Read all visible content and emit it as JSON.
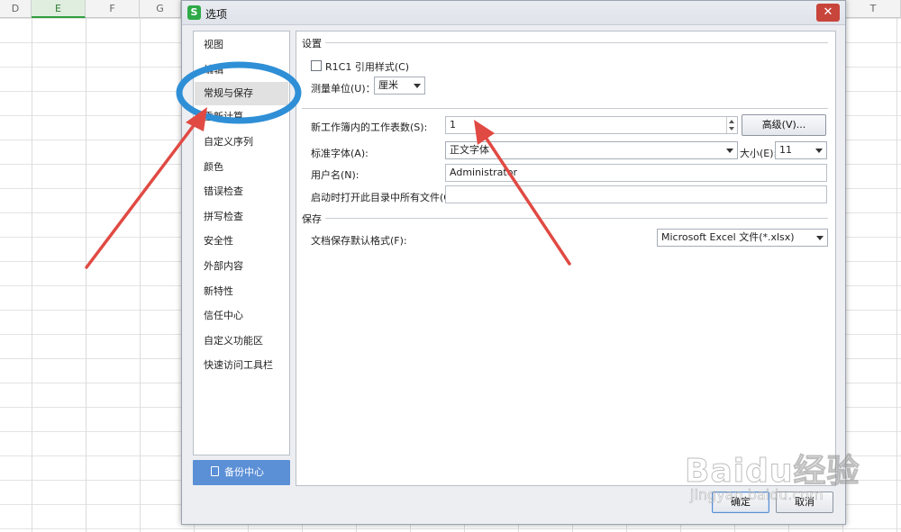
{
  "spreadsheet": {
    "columns": [
      "D",
      "E",
      "F",
      "G",
      "T"
    ],
    "selected_column": "E"
  },
  "dialog": {
    "title": "选项",
    "app_icon": "S",
    "close_label": "✕"
  },
  "nav": {
    "items": [
      {
        "label": "视图"
      },
      {
        "label": "编辑"
      },
      {
        "label": "常规与保存"
      },
      {
        "label": "重新计算"
      },
      {
        "label": "自定义序列"
      },
      {
        "label": "颜色"
      },
      {
        "label": "错误检查"
      },
      {
        "label": "拼写检查"
      },
      {
        "label": "安全性"
      },
      {
        "label": "外部内容"
      },
      {
        "label": "新特性"
      },
      {
        "label": "信任中心"
      },
      {
        "label": "自定义功能区"
      },
      {
        "label": "快速访问工具栏"
      }
    ],
    "active_index": 2,
    "backup_label": "备份中心"
  },
  "settings": {
    "group_title": "设置",
    "r1c1_label": "R1C1 引用样式(C)",
    "r1c1_checked": false,
    "unit_label": "测量单位(U)：",
    "unit_value": "厘米",
    "sheets_label": "新工作簿内的工作表数(S):",
    "sheets_value": "1",
    "advanced_label": "高级(V)...",
    "font_label": "标准字体(A):",
    "font_value": "正文字体",
    "size_label": "大小(E):",
    "size_value": "11",
    "username_label": "用户名(N):",
    "username_value": "Administrator",
    "startup_label": "启动时打开此目录中所有文件(O):",
    "startup_value": ""
  },
  "save": {
    "group_title": "保存",
    "format_label": "文档保存默认格式(F):",
    "format_value": "Microsoft Excel 文件(*.xlsx)"
  },
  "footer": {
    "ok_label": "确定",
    "cancel_label": "取消"
  },
  "annotation_colors": {
    "circle": "#2f8fd6",
    "arrow": "#e04a43"
  },
  "watermark": {
    "logo_text": "Baidu经验",
    "url_text": "jingyan.baidu.com"
  }
}
